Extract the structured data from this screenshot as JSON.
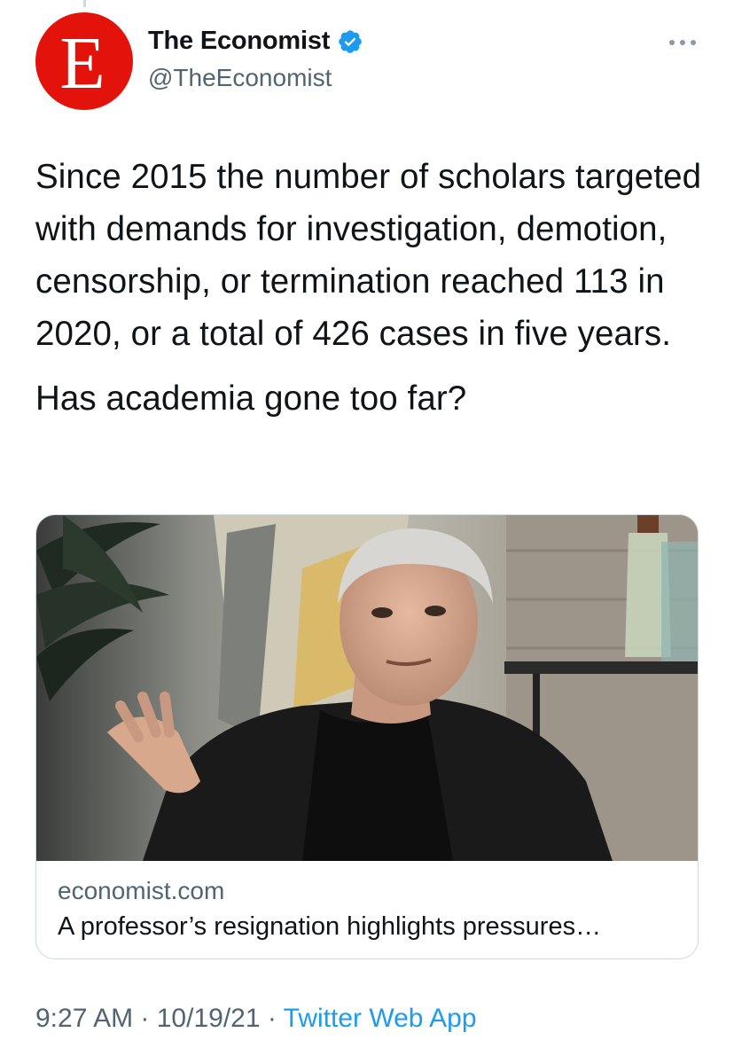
{
  "author": {
    "avatar_letter": "E",
    "display_name": "The Economist",
    "handle": "@TheEconomist",
    "verified": true,
    "brand_color": "#e3120b"
  },
  "tweet": {
    "text": "Since 2015 the number of scholars targeted with demands for investigation, demotion, censorship, or termination reached 113 in 2020, or a total of 426 cases in five years.",
    "question": "Has academia gone too far?"
  },
  "card": {
    "image_icon": "photo-icon",
    "domain": "economist.com",
    "title": "A professor’s resignation highlights pressures…"
  },
  "meta": {
    "time": "9:27 AM",
    "separator": " · ",
    "date": "10/19/21",
    "source": "Twitter Web App",
    "accent_color": "#1d9bf0"
  },
  "icons": {
    "more": "more-horizontal-icon",
    "verified": "verified-badge-icon"
  }
}
